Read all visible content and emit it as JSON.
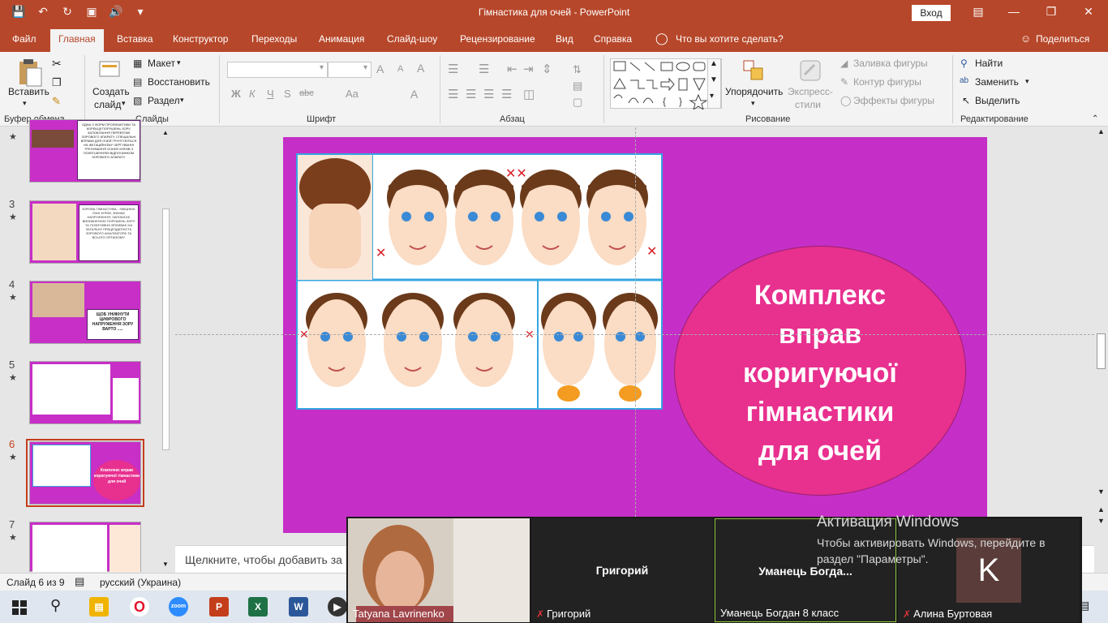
{
  "window": {
    "title": "Гімнастика для очей  -  PowerPoint",
    "signin": "Вход"
  },
  "tabs": [
    "Файл",
    "Главная",
    "Вставка",
    "Конструктор",
    "Переходы",
    "Анимация",
    "Слайд-шоу",
    "Рецензирование",
    "Вид",
    "Справка"
  ],
  "tell_me": "Что вы хотите сделать?",
  "share": "Поделиться",
  "ribbon": {
    "clipboard": {
      "paste": "Вставить",
      "label": "Буфер обмена"
    },
    "slides": {
      "new_slide_1": "Создать",
      "new_slide_2": "слайд",
      "layout": "Макет",
      "reset": "Восстановить",
      "section": "Раздел",
      "label": "Слайды"
    },
    "font": {
      "bold": "Ж",
      "italic": "К",
      "underline": "Ч",
      "strike": "S",
      "abc": "abc",
      "aa": "Aa",
      "grow": "A",
      "shrink": "A",
      "clear": "A",
      "color": "A",
      "label": "Шрифт"
    },
    "paragraph": {
      "label": "Абзац"
    },
    "drawing": {
      "arrange_1": "Упорядочить",
      "express_1": "Экспресс-",
      "express_2": "стили",
      "fill": "Заливка фигуры",
      "outline": "Контур фигуры",
      "effects": "Эффекты фигуры",
      "label": "Рисование"
    },
    "editing": {
      "find": "Найти",
      "replace": "Заменить",
      "select": "Выделить",
      "label": "Редактирование"
    }
  },
  "thumbnails": [
    {
      "num": "3",
      "text": "ЗОРОВА ГІМНАСТИКА - ЗМІЦНЮЄ ОЧНІ М'ЯЗИ, ЗНІМАЄ НАПРУЖЕННЯ, ЗАПОБІГАЄ ВИНИКНЕННЮ ПОРУШЕНЬ ЗОРУ ТА ПОЗИТИВНО ВПЛИВАЄ НА ЗАГАЛЬНУ ПРАЦЕЗДАТНІСТЬ ЗОРОВОГО АНАЛІЗАТОРА ТА ВСЬОГО ОРГАНІЗМУ."
    },
    {
      "num": "4",
      "text": "ЩОБ УНИКНУТИ ЦИФРОВОГО НАПРУЖЕННЯ ЗОРУ ВАРТО ....."
    },
    {
      "num": "5",
      "text": ""
    },
    {
      "num": "6",
      "text": "Комплекс вправ коригуючої гімнастики для очей"
    },
    {
      "num": "7",
      "text": ""
    }
  ],
  "thumb_top_text": "ОДНА З ФОРМ ПРОФІЛАКТИКИ ТА КОРЕКЦІЇ ПОРУШЕНЬ ЗОРУ, ЗАПОБІГАННЯ ПЕРЕВТОМІ ЗОРОВОГО АПАРАТУ. СПЕЦІАЛЬНІ ВПРАВИ ДЛЯ ОЧЕЙ ГРУНТУЮТЬСЯ НА ІМІТАЦІЙНОМУ ЧЕРГУВАННІ ТРЕНУВАННЯ ОЧНИХ М'ЯЗІВ З ПОЛЕГШЕННЯМ ВІДПОЧИНКОМ ЗОРОВОГО АПАРАТУ.",
  "slide": {
    "title_lines": [
      "Комплекс",
      "вправ",
      "коригуючої",
      "гімнастики",
      "для очей"
    ]
  },
  "notes_placeholder": "Щелкните, чтобы добавить за",
  "status": {
    "slide_of": "Слайд 6 из 9",
    "language": "русский (Украина)"
  },
  "zoom": {
    "tiles": [
      {
        "center": "",
        "label": "Tatyana Lavrinenko",
        "muted": false
      },
      {
        "center": "Григорий",
        "label": "Григорий",
        "muted": true
      },
      {
        "center": "Уманець  Богда...",
        "label": "Уманець Богдан 8 класс",
        "muted": false
      },
      {
        "center": "K",
        "label": "Алина Буртовая",
        "muted": true
      }
    ]
  },
  "activation": {
    "title": "Активация Windows",
    "line1": "Чтобы активировать Windows, перейдите в",
    "line2": "раздел \"Параметры\"."
  },
  "colors": {
    "accent": "#b7472a",
    "slide_bg": "#c52fc7",
    "ellipse": "#e8308f",
    "zoom_active": "#8ec63f"
  }
}
